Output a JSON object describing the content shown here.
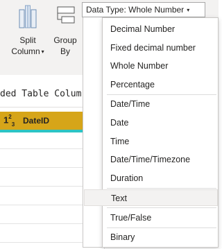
{
  "ribbon": {
    "split_column": {
      "line1": "Split",
      "line2": "Column",
      "caret": "▾",
      "icon": "split-column-icon"
    },
    "group_by": {
      "line1": "Group",
      "line2": "By",
      "icon": "group-by-icon"
    }
  },
  "formula": {
    "text": "ded Table Colum"
  },
  "column": {
    "type_icon": "123-integer-type-icon",
    "name": "DateID"
  },
  "data_type": {
    "button_label": "Data Type: Whole Number",
    "caret": "▾",
    "items": [
      "Decimal Number",
      "Fixed decimal number",
      "Whole Number",
      "Percentage",
      "Date/Time",
      "Date",
      "Time",
      "Date/Time/Timezone",
      "Duration",
      "Text",
      "True/False",
      "Binary"
    ],
    "hovered_item": "Text"
  },
  "colors": {
    "column_header": "#d6a519",
    "header_underline": "#2cc4c4",
    "ribbon_bg": "#f3f2f1",
    "menu_hover": "#f3f2f1"
  }
}
